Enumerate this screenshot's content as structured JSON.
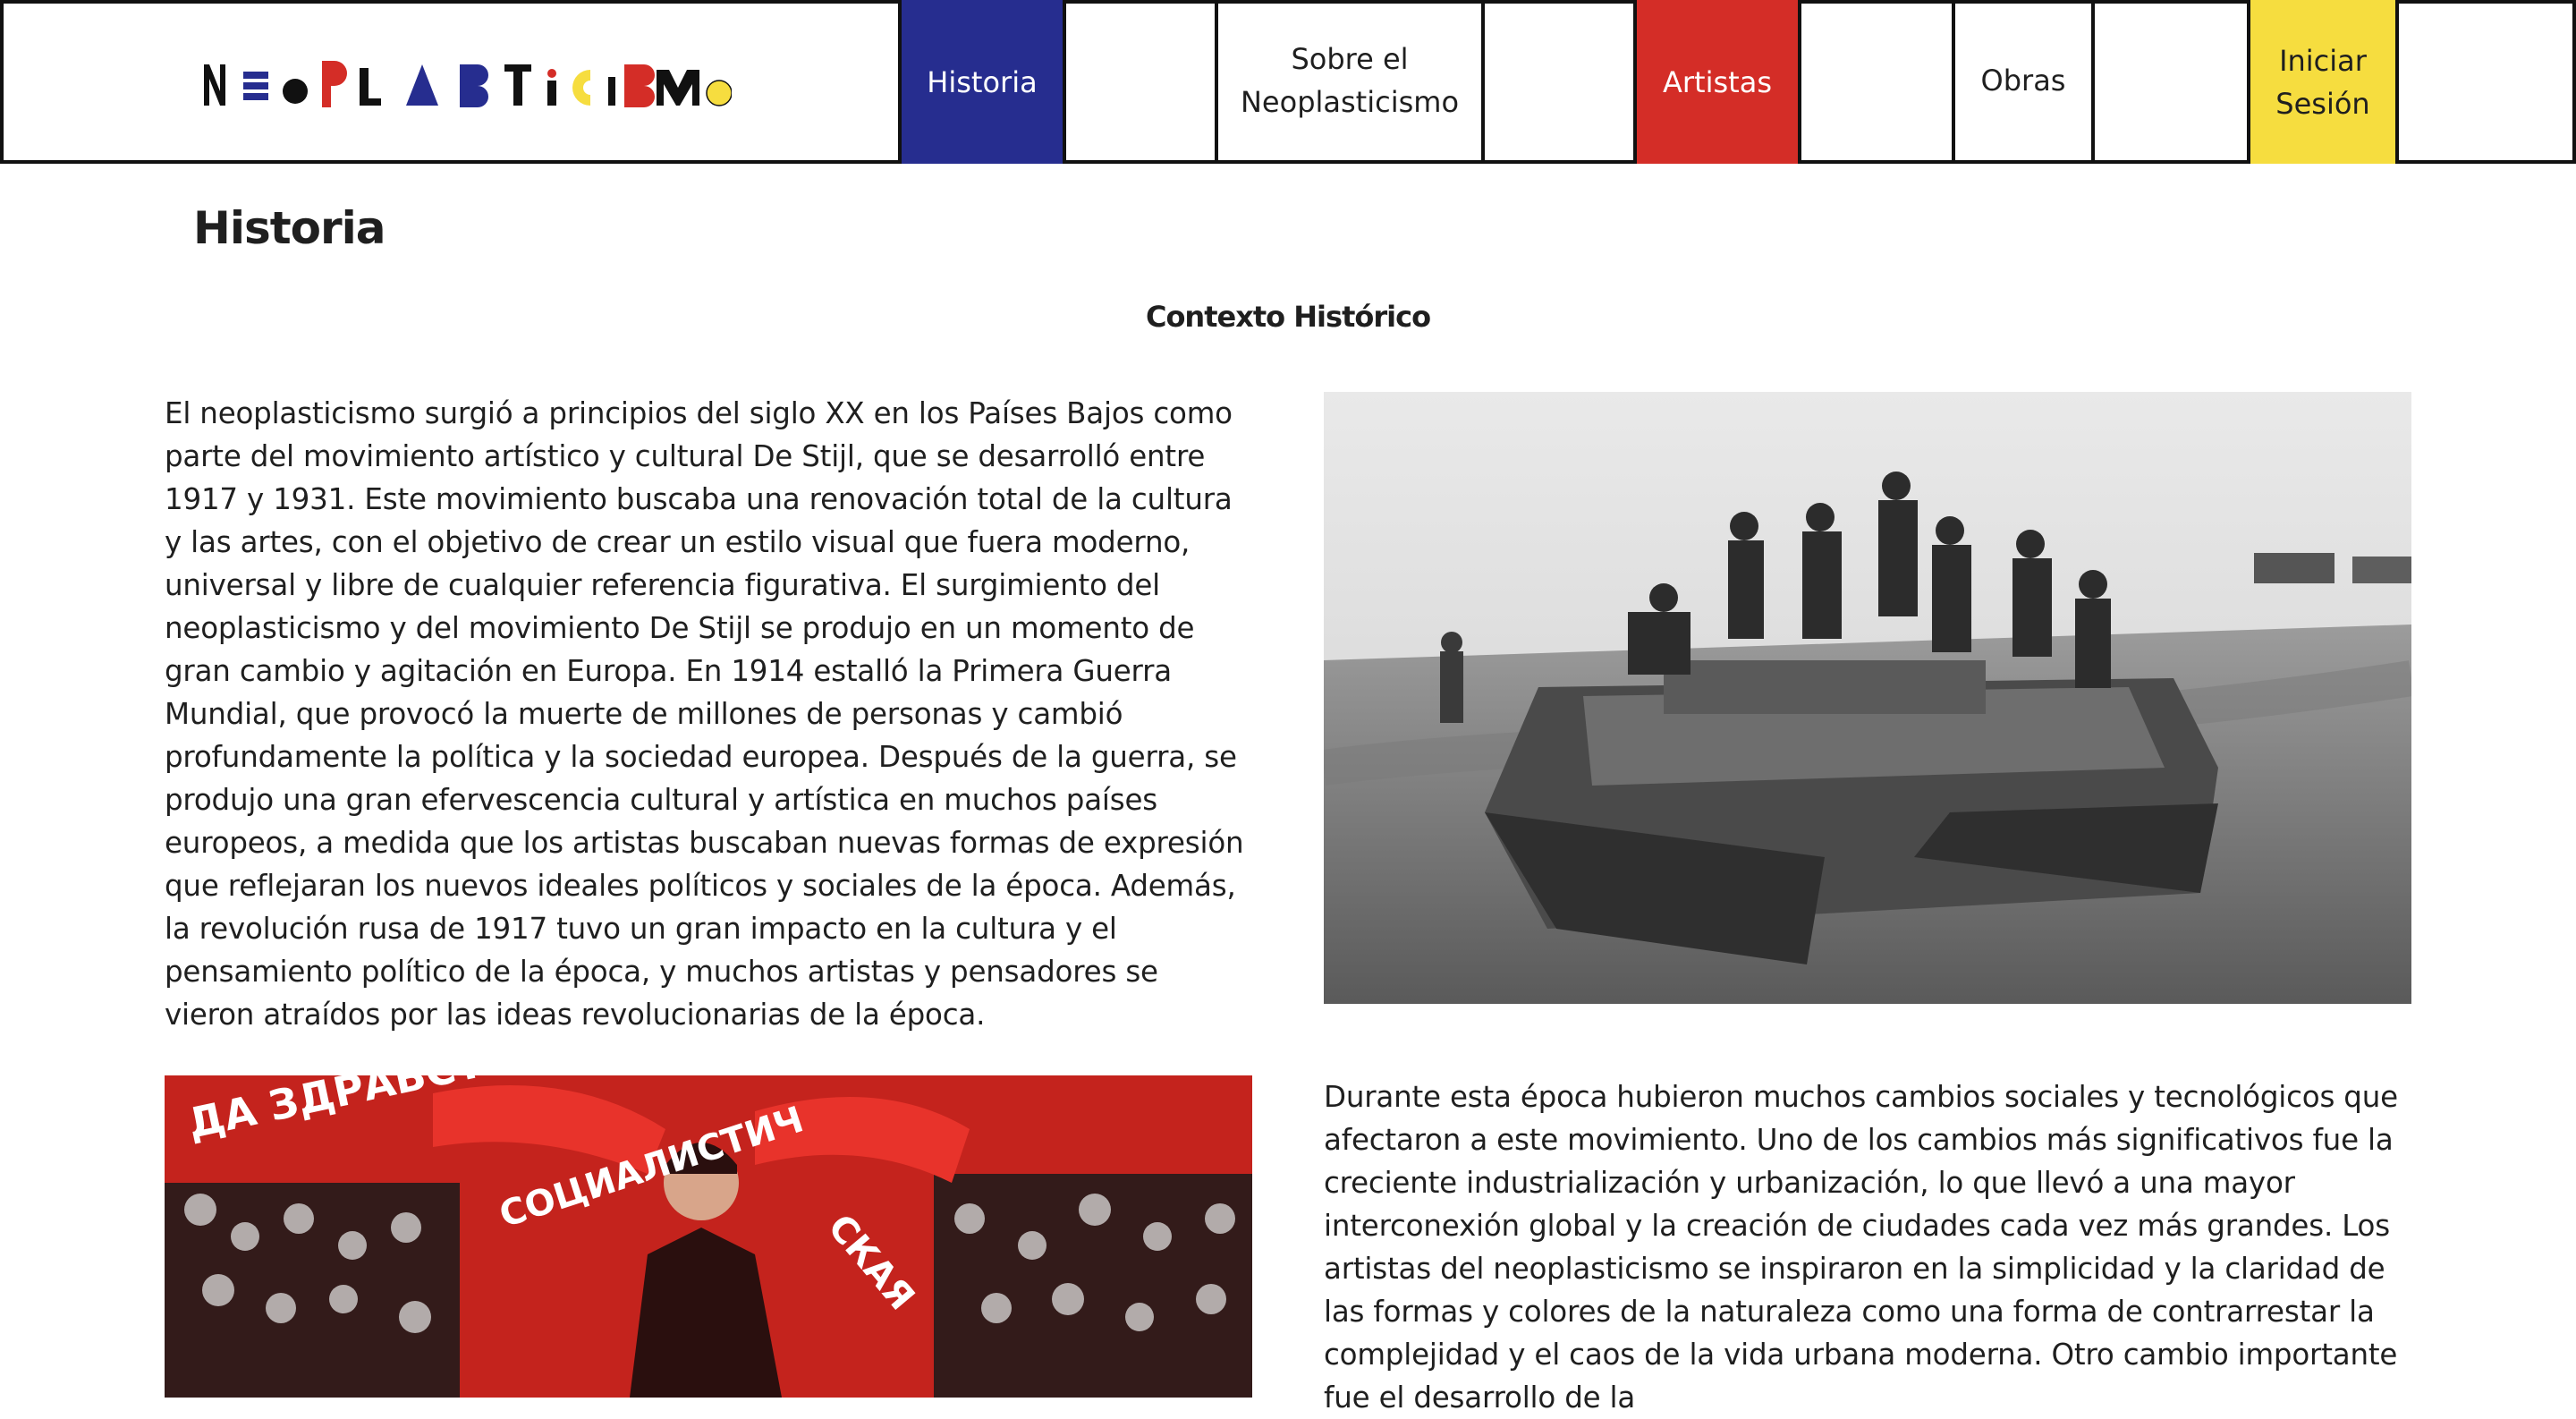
{
  "brand": {
    "logo_text": "NEOPLASTICISMO",
    "colors": {
      "blue": "#262d8f",
      "red": "#d42d27",
      "yellow": "#f6dd3f",
      "black": "#111111"
    }
  },
  "nav": {
    "items": [
      {
        "label": "Historia",
        "style": "blue",
        "active": true
      },
      {
        "label": "Sobre el\nNeoplasticismo",
        "style": "white"
      },
      {
        "label": "Artistas",
        "style": "red"
      },
      {
        "label": "Obras",
        "style": "white"
      },
      {
        "label": "Iniciar\nSesión",
        "style": "yellow"
      }
    ]
  },
  "main": {
    "page_title": "Historia",
    "section_title": "Contexto Histórico",
    "paragraph_1": "El neoplasticismo surgió a principios del siglo XX en los Países Bajos como parte del movimiento artístico y cultural De Stijl, que se desarrolló entre 1917 y 1931. Este movimiento buscaba una renovación total de la cultura y las artes, con el objetivo de crear un estilo visual que fuera moderno, universal y libre de cualquier referencia figurativa. El surgimiento del neoplasticismo y del movimiento De Stijl se produjo en un momento de gran cambio y agitación en Europa. En 1914 estalló la Primera Guerra Mundial, que provocó la muerte de millones de personas y cambió profundamente la política y la sociedad europea. Después de la guerra, se produjo una gran efervescencia cultural y artística en muchos países europeos, a medida que los artistas buscaban nuevas formas de expresión que reflejaran los nuevos ideales políticos y sociales de la época. Además, la revolución rusa de 1917 tuvo un gran impacto en la cultura y el pensamiento político de la época, y muchos artistas y pensadores se vieron atraídos por las ideas revolucionarias de la época.",
    "paragraph_2": "Durante esta época hubieron muchos cambios sociales y tecnológicos que afectaron a este movimiento. Uno de los cambios más significativos fue la creciente industrialización y urbanización, lo que llevó a una mayor interconexión global y la creación de ciudades cada vez más grandes. Los artistas del neoplasticismo se inspiraron en la simplicidad y la claridad de las formas y colores de la naturaleza como una forma de contrarrestar la complejidad y el caos de la vida urbana moderna. Otro cambio importante fue el desarrollo de la",
    "poster_text": [
      "ДА ЗДРАВСТВУЕТ",
      "СОЦИАЛИСТИЧ",
      "СКАЯ"
    ]
  }
}
